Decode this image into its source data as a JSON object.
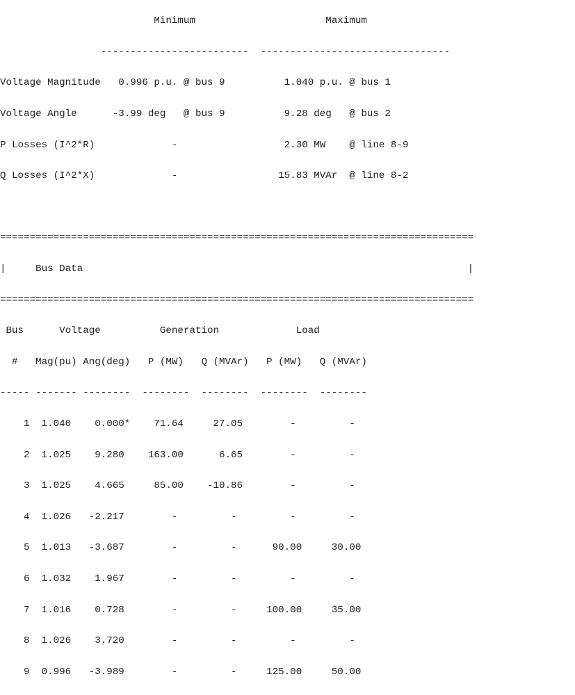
{
  "summary": {
    "header_line": "                          Minimum                      Maximum",
    "rule_line": "                 -------------------------  --------------------------------",
    "rows": [
      "Voltage Magnitude   0.996 p.u. @ bus 9          1.040 p.u. @ bus 1",
      "Voltage Angle      -3.99 deg   @ bus 9          9.28 deg   @ bus 2",
      "P Losses (I^2*R)             -                  2.30 MW    @ line 8-9",
      "Q Losses (I^2*X)             -                 15.83 MVAr  @ line 8-2"
    ]
  },
  "bus_data": {
    "double_rule": "================================================================================",
    "title_line": "|     Bus Data                                                                 |",
    "header1": " Bus      Voltage          Generation             Load",
    "header2": "  #   Mag(pu) Ang(deg)   P (MW)   Q (MVAr)   P (MW)   Q (MVAr)",
    "dash_line": "----- ------- --------  --------  --------  --------  --------",
    "rows": [
      "    1  1.040    0.000*    71.64     27.05        -         -",
      "    2  1.025    9.280    163.00      6.65        -         -",
      "    3  1.025    4.665     85.00    -10.86        -         -",
      "    4  1.026   -2.217        -         -         -         -",
      "    5  1.013   -3.687        -         -      90.00     30.00",
      "    6  1.032    1.967        -         -         -         -",
      "    7  1.016    0.728        -         -     100.00     35.00",
      "    8  1.026    3.720        -         -         -         -",
      "    9  0.996   -3.989        -         -     125.00     50.00"
    ]
  }
}
